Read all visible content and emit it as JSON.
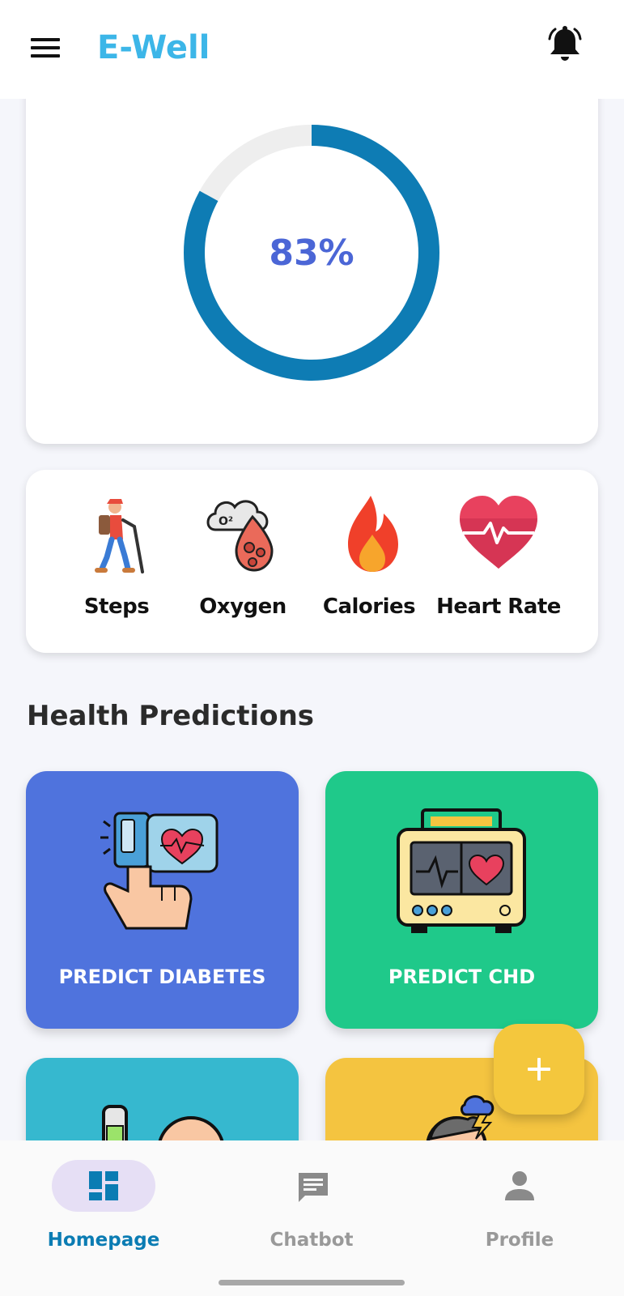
{
  "app_bar": {
    "title": "E-Well",
    "menu_icon": "hamburger-menu-icon",
    "notification_icon": "bell-ringing-icon"
  },
  "progress": {
    "value_text": "83%",
    "fraction": 0.83,
    "color": "#0e7cb4",
    "track_color": "#eeeeee"
  },
  "metrics": [
    {
      "label": "Steps",
      "icon": "hiker-icon"
    },
    {
      "label": "Oxygen",
      "icon": "oxygen-blood-drop-icon"
    },
    {
      "label": "Calories",
      "icon": "flame-icon"
    },
    {
      "label": "Heart Rate",
      "icon": "heart-pulse-icon"
    }
  ],
  "section": {
    "title": "Health Predictions"
  },
  "predictions": [
    {
      "label": "PREDICT DIABETES",
      "icon": "glucose-meter-finger-icon",
      "color": "#4f73dd"
    },
    {
      "label": "PREDICT CHD",
      "icon": "heart-monitor-icon",
      "color": "#1fc98a"
    },
    {
      "label": "",
      "icon": "inhaler-icon",
      "color": "#36b8cf"
    },
    {
      "label": "",
      "icon": "headache-person-icon",
      "color": "#f4c440"
    }
  ],
  "fab": {
    "icon": "plus-icon",
    "color": "#f4c73d"
  },
  "bottom_nav": {
    "items": [
      {
        "label": "Homepage",
        "icon": "dashboard-icon",
        "active": true
      },
      {
        "label": "Chatbot",
        "icon": "chat-icon",
        "active": false
      },
      {
        "label": "Profile",
        "icon": "person-icon",
        "active": false
      }
    ]
  }
}
